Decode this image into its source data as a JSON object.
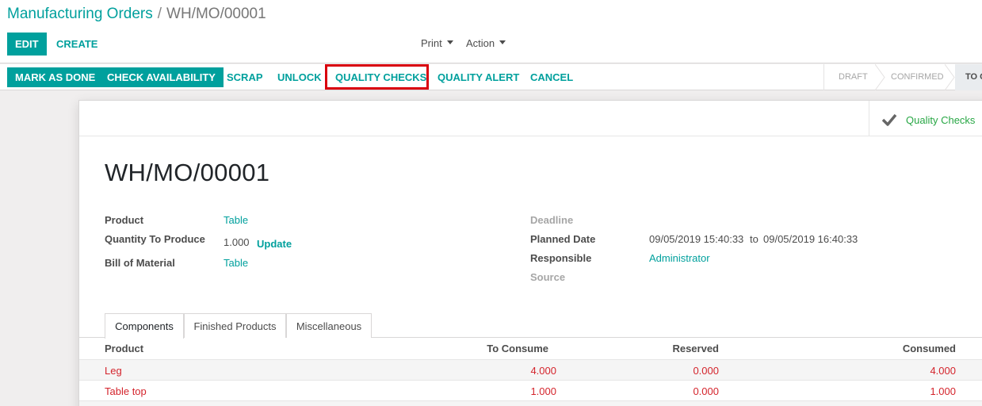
{
  "breadcrumb": {
    "parent": "Manufacturing Orders",
    "separator": "/",
    "current": "WH/MO/00001"
  },
  "control_panel": {
    "edit_label": "EDIT",
    "create_label": "CREATE",
    "print_label": "Print",
    "action_label": "Action"
  },
  "statusbar": {
    "buttons": [
      "MARK AS DONE",
      "CHECK AVAILABILITY",
      "SCRAP",
      "UNLOCK",
      "QUALITY CHECKS",
      "QUALITY ALERT",
      "CANCEL"
    ],
    "highlighted_button": "QUALITY CHECKS",
    "stages": [
      "DRAFT",
      "CONFIRMED",
      "TO C"
    ],
    "active_stage": "TO C"
  },
  "smart_button": {
    "label": "Quality Checks",
    "icon": "check-icon"
  },
  "record": {
    "name": "WH/MO/00001",
    "product_label": "Product",
    "product_value": "Table",
    "qty_label": "Quantity To Produce",
    "qty_value": "1.000",
    "update_label": "Update",
    "bom_label": "Bill of Material",
    "bom_value": "Table",
    "deadline_label": "Deadline",
    "planned_label": "Planned Date",
    "planned_start": "09/05/2019 15:40:33",
    "planned_to": "to",
    "planned_end": "09/05/2019 16:40:33",
    "responsible_label": "Responsible",
    "responsible_value": "Administrator",
    "source_label": "Source"
  },
  "tabs": [
    "Components",
    "Finished Products",
    "Miscellaneous"
  ],
  "components": {
    "headers": [
      "Product",
      "To Consume",
      "Reserved",
      "Consumed"
    ],
    "rows": [
      [
        "Leg",
        "4.000",
        "0.000",
        "4.000"
      ],
      [
        "Table top",
        "1.000",
        "0.000",
        "1.000"
      ]
    ]
  },
  "colors": {
    "primary": "#00a09d",
    "highlight_border": "#d9000d",
    "row_text": "#d4242c",
    "smart_button": "#28a745"
  }
}
